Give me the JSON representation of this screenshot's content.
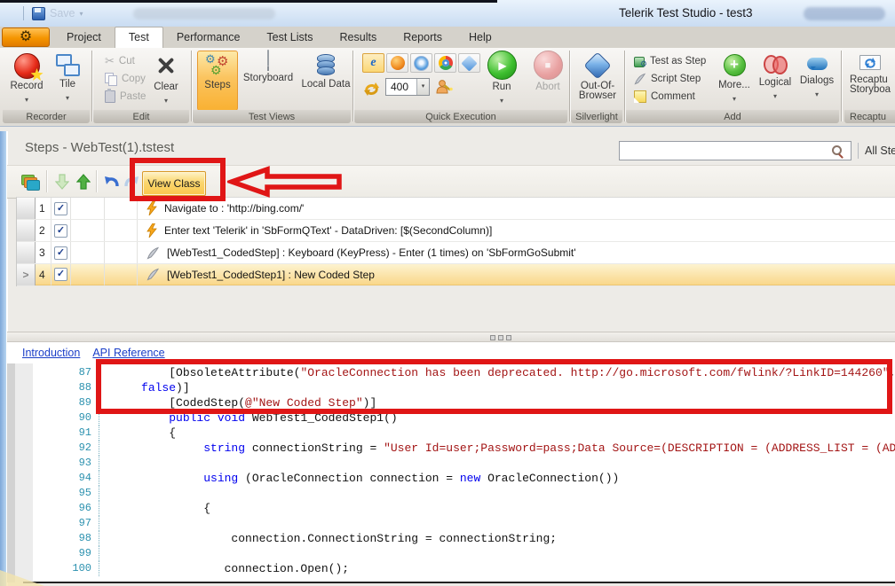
{
  "titlebar": {
    "save": "Save",
    "title": "Telerik Test Studio - test3"
  },
  "tabs": {
    "items": [
      "Project",
      "Test",
      "Performance",
      "Test Lists",
      "Results",
      "Reports",
      "Help"
    ],
    "selected": "Test"
  },
  "ribbon": {
    "recorder": {
      "label": "Recorder",
      "record": "Record",
      "tile": "Tile"
    },
    "edit": {
      "label": "Edit",
      "cut": "Cut",
      "copy": "Copy",
      "paste": "Paste",
      "clear": "Clear"
    },
    "test_views": {
      "label": "Test Views",
      "steps": "Steps",
      "storyboard": "Storyboard",
      "local_data": "Local Data"
    },
    "quick_execution": {
      "label": "Quick Execution",
      "speed": "400",
      "run": "Run",
      "abort": "Abort"
    },
    "silverlight": {
      "label": "Silverlight",
      "oob_line1": "Out-Of-",
      "oob_line2": "Browser"
    },
    "add": {
      "label": "Add",
      "test_as_step": "Test as Step",
      "script_step": "Script Step",
      "comment": "Comment",
      "more": "More...",
      "logical": "Logical",
      "dialogs": "Dialogs"
    },
    "recapture": {
      "label": "Recaptu",
      "line1": "Recaptu",
      "line2": "Storyboa"
    }
  },
  "steps_panel": {
    "title": "Steps - WebTest(1).tstest",
    "view_class": "View Class",
    "filter": "All Step",
    "search_value": ""
  },
  "steps": [
    {
      "num": "1",
      "icon": "lightning",
      "checked": true,
      "selected": false,
      "text": "Navigate to : 'http://bing.com/'"
    },
    {
      "num": "2",
      "icon": "lightning",
      "checked": true,
      "selected": false,
      "text": "Enter text 'Telerik' in 'SbFormQText' - DataDriven: [$(SecondColumn)]"
    },
    {
      "num": "3",
      "icon": "quill",
      "checked": true,
      "selected": false,
      "text": "[WebTest1_CodedStep] : Keyboard (KeyPress) - Enter (1 times) on 'SbFormGoSubmit'"
    },
    {
      "num": "4",
      "icon": "quill",
      "checked": true,
      "selected": true,
      "text": "[WebTest1_CodedStep1] : New Coded Step"
    }
  ],
  "docs_links": [
    "Introduction",
    "API Reference"
  ],
  "code": {
    "lines": [
      {
        "num": "87",
        "segs": [
          {
            "t": "         [ObsoleteAttribute(",
            "c": "p"
          },
          {
            "t": "\"OracleConnection has been deprecated. http://go.microsoft.com/fwlink/?LinkID=144260\"",
            "c": "s"
          },
          {
            "t": ",",
            "c": "p"
          }
        ]
      },
      {
        "num": "88",
        "segs": [
          {
            "t": "     ",
            "c": "p"
          },
          {
            "t": "false",
            "c": "k"
          },
          {
            "t": ")]",
            "c": "p"
          }
        ]
      },
      {
        "num": "89",
        "segs": [
          {
            "t": "         [CodedStep(",
            "c": "p"
          },
          {
            "t": "@\"New Coded Step\"",
            "c": "s"
          },
          {
            "t": ")]",
            "c": "p"
          }
        ]
      },
      {
        "num": "90",
        "segs": [
          {
            "t": "         ",
            "c": "p"
          },
          {
            "t": "public",
            "c": "k"
          },
          {
            "t": " ",
            "c": "p"
          },
          {
            "t": "void",
            "c": "k"
          },
          {
            "t": " WebTest1_CodedStep1()",
            "c": "p"
          }
        ]
      },
      {
        "num": "91",
        "segs": [
          {
            "t": "         {",
            "c": "p"
          }
        ]
      },
      {
        "num": "92",
        "segs": [
          {
            "t": "              ",
            "c": "p"
          },
          {
            "t": "string",
            "c": "k"
          },
          {
            "t": " connectionString = ",
            "c": "p"
          },
          {
            "t": "\"User Id=user;Password=pass;Data Source=(DESCRIPTION = (ADDRESS_LIST = (ADDRE",
            "c": "s"
          }
        ]
      },
      {
        "num": "93",
        "segs": []
      },
      {
        "num": "94",
        "segs": [
          {
            "t": "              ",
            "c": "p"
          },
          {
            "t": "using",
            "c": "k"
          },
          {
            "t": " (OracleConnection connection = ",
            "c": "p"
          },
          {
            "t": "new",
            "c": "k"
          },
          {
            "t": " OracleConnection())",
            "c": "p"
          }
        ]
      },
      {
        "num": "95",
        "segs": []
      },
      {
        "num": "96",
        "segs": [
          {
            "t": "              {",
            "c": "p"
          }
        ]
      },
      {
        "num": "97",
        "segs": []
      },
      {
        "num": "98",
        "segs": [
          {
            "t": "                  connection.ConnectionString = connectionString;",
            "c": "p"
          }
        ]
      },
      {
        "num": "99",
        "segs": []
      },
      {
        "num": "100",
        "segs": [
          {
            "t": "                 connection.Open();",
            "c": "p"
          }
        ]
      }
    ]
  },
  "icons": {
    "app_gear": "gear-icon",
    "record": "record-sphere-icon",
    "lightning": "lightning-icon",
    "quill": "quill-icon",
    "run": "play-icon",
    "abort": "stop-icon",
    "search": "magnifier-icon"
  },
  "colors": {
    "annotation": "#e01616",
    "selection_row": "#f9d78a",
    "ribbon_selected": "#fbd775",
    "keyword": "#0000ee",
    "string": "#a31515",
    "line_number": "#2B91AF",
    "titlebar": "#c9dcf2"
  }
}
